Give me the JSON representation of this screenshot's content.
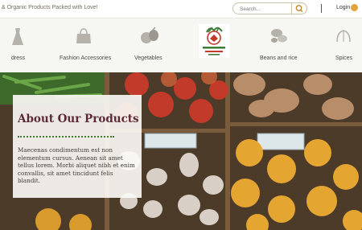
{
  "topbar": {
    "tagline": "& Organic Products Packed with Love!",
    "search_placeholder": "Search...",
    "search_icon": "magnifier-icon",
    "login_label": "Login",
    "login_icon": "user-icon"
  },
  "categories": [
    {
      "label": "dress",
      "icon": "dress-icon"
    },
    {
      "label": "Fashion Accessories",
      "icon": "handbag-icon"
    },
    {
      "label": "Vegetables",
      "icon": "vegetables-icon"
    },
    {
      "label": "Beans and rice",
      "icon": "beans-icon"
    },
    {
      "label": "Spices",
      "icon": "spices-icon"
    }
  ],
  "logo": {
    "name": "jaibhumika brand logo"
  },
  "hero": {
    "title": "About Our Products",
    "body": "Maecenas condimentum est non elementum cursus. Aenean sit amet tellus lorem. Morbi aliquet nibh et enim convallis, sit amet tincidunt felis blandit."
  },
  "colors": {
    "title": "#5c2a35",
    "accent_green": "#3d7a35",
    "login_icon": "#e3a23a"
  }
}
